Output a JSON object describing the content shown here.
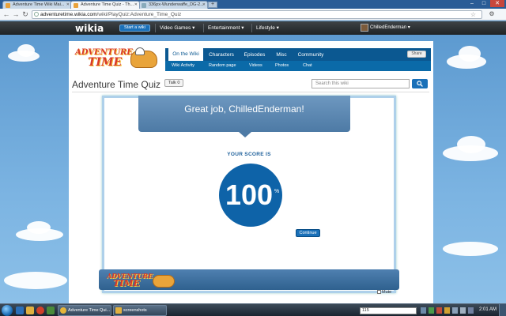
{
  "browser": {
    "tabs": [
      {
        "label": "Adventure Time Wiki Mai..."
      },
      {
        "label": "Adventure Time Quiz - Th..."
      },
      {
        "label": "336px-Wunderwaffe_DG-2..."
      }
    ],
    "new_tab_label": "+",
    "window_controls": {
      "minimize": "–",
      "maximize": "□",
      "close": "✕"
    },
    "url_host": "adventuretime.wikia.com",
    "url_path": "/wiki/PlayQuiz:Adventure_Time_Quiz",
    "back_glyph": "←",
    "forward_glyph": "→",
    "reload_glyph": "↻",
    "star_glyph": "☆",
    "wrench_glyph": "⚙"
  },
  "global_nav": {
    "logo": "wikia",
    "start_wiki": "Start a wiki",
    "items": [
      {
        "label": "Video Games ▾"
      },
      {
        "label": "Entertainment ▾"
      },
      {
        "label": "Lifestyle ▾"
      }
    ],
    "username": "ChilledEnderman ▾"
  },
  "wiki": {
    "wordmark_line1": "ADVENTURE",
    "wordmark_line2": "TIME",
    "tabs": [
      {
        "label": "On the Wiki",
        "active": true
      },
      {
        "label": "Characters"
      },
      {
        "label": "Episodes"
      },
      {
        "label": "Misc"
      },
      {
        "label": "Community"
      }
    ],
    "subnav": [
      {
        "label": "Wiki Activity"
      },
      {
        "label": "Random page"
      },
      {
        "label": "Videos"
      },
      {
        "label": "Photos"
      },
      {
        "label": "Chat"
      }
    ],
    "share_label": "Share",
    "page_title": "Adventure Time Quiz",
    "talk_label": "Talk",
    "talk_count": "0",
    "search_placeholder": "Search this wiki",
    "search_icon": "magnifier-icon"
  },
  "quiz": {
    "message": "Great job, ChilledEnderman!",
    "score_label": "YOUR SCORE IS",
    "score": "100",
    "score_unit": "%",
    "continue_label": "Continue",
    "mute_label": "Mute",
    "footer_logo_line1": "ADVENTURE",
    "footer_logo_line2": "TIME"
  },
  "taskbar": {
    "tasks": [
      {
        "label": "Adventure Time Qui..."
      },
      {
        "label": "screenshots"
      }
    ],
    "address_value": "115",
    "clock": "2:01 AM"
  },
  "colors": {
    "wiki_nav": "#0b5891",
    "score_circle": "#0e63a8",
    "bubble": "#4d7aa5",
    "sky": "#6aa3d4"
  }
}
